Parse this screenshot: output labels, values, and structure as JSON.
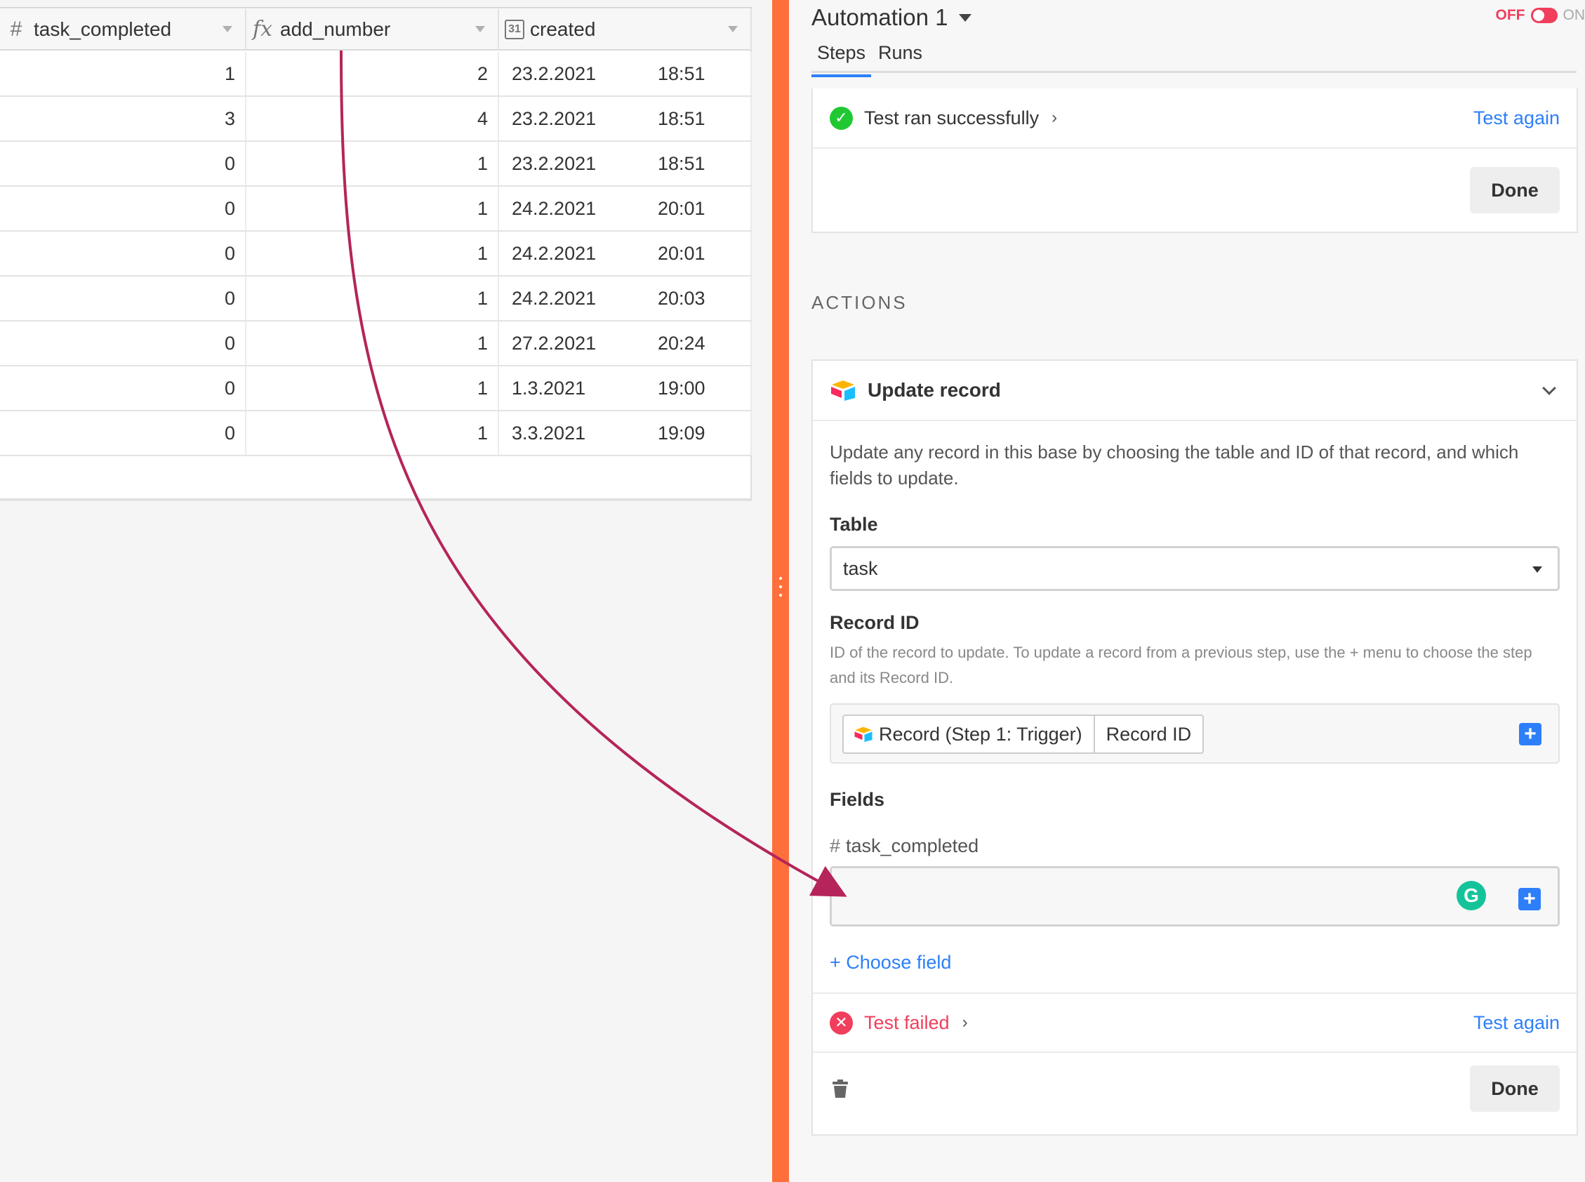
{
  "grid": {
    "columns": [
      {
        "type_icon": "#",
        "label": "task_completed"
      },
      {
        "type_icon": "fx",
        "label": "add_number"
      },
      {
        "type_icon": "31",
        "label": "created"
      }
    ],
    "rows": [
      {
        "task_completed": "1",
        "add_number": "2",
        "date": "23.2.2021",
        "time": "18:51"
      },
      {
        "task_completed": "3",
        "add_number": "4",
        "date": "23.2.2021",
        "time": "18:51"
      },
      {
        "task_completed": "0",
        "add_number": "1",
        "date": "23.2.2021",
        "time": "18:51"
      },
      {
        "task_completed": "0",
        "add_number": "1",
        "date": "24.2.2021",
        "time": "20:01"
      },
      {
        "task_completed": "0",
        "add_number": "1",
        "date": "24.2.2021",
        "time": "20:01"
      },
      {
        "task_completed": "0",
        "add_number": "1",
        "date": "24.2.2021",
        "time": "20:03"
      },
      {
        "task_completed": "0",
        "add_number": "1",
        "date": "27.2.2021",
        "time": "20:24"
      },
      {
        "task_completed": "0",
        "add_number": "1",
        "date": "1.3.2021",
        "time": "19:00"
      },
      {
        "task_completed": "0",
        "add_number": "1",
        "date": "3.3.2021",
        "time": "19:09"
      }
    ]
  },
  "automation": {
    "title": "Automation 1",
    "toggle_off": "OFF",
    "toggle_on": "ON",
    "tabs": {
      "steps": "Steps",
      "runs": "Runs"
    }
  },
  "trigger": {
    "status": "Test ran successfully",
    "test_again": "Test again",
    "done": "Done"
  },
  "actions_label": "ACTIONS",
  "action": {
    "title": "Update record",
    "description": "Update any record in this base by choosing the table and ID of that record, and which fields to update.",
    "table_label": "Table",
    "table_value": "task",
    "record_id_label": "Record ID",
    "record_id_help": "ID of the record to update. To update a record from a previous step, use the + menu to choose the step and its Record ID.",
    "token_source": "Record (Step 1: Trigger)",
    "token_field": "Record ID",
    "fields_label": "Fields",
    "field_name": "task_completed",
    "field_icon": "#",
    "choose_field": "+ Choose field",
    "status": "Test failed",
    "test_again": "Test again",
    "done": "Done"
  },
  "colors": {
    "divider": "#ff6f3c",
    "accent_blue": "#2d7ff9",
    "success_green": "#20c933",
    "error_red": "#f03e5c",
    "annotation_arrow": "#b5245a"
  },
  "icons": {
    "status_success": "check-circle-icon",
    "status_failed": "x-circle-icon",
    "add": "plus-square-icon",
    "trash": "trash-icon",
    "grammarly": "grammarly-icon"
  }
}
